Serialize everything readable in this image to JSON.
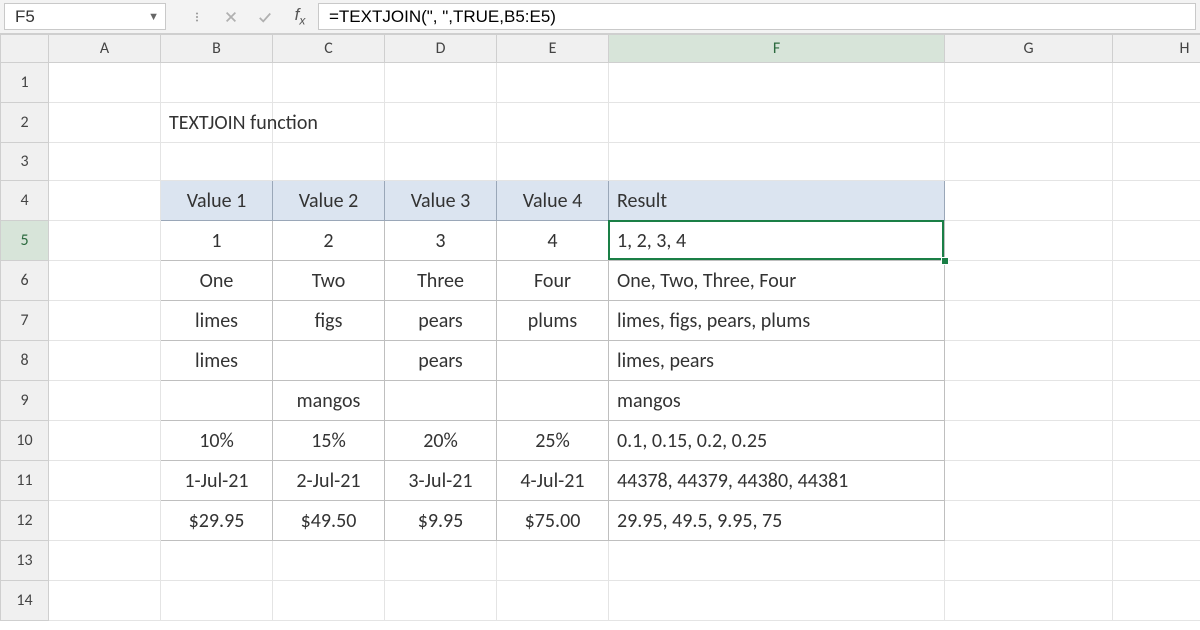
{
  "name_box": "F5",
  "formula": "=TEXTJOIN(\", \",TRUE,B5:E5)",
  "fx_label": "fx",
  "columns": [
    "A",
    "B",
    "C",
    "D",
    "E",
    "F",
    "G",
    "H"
  ],
  "rows": [
    "1",
    "2",
    "3",
    "4",
    "5",
    "6",
    "7",
    "8",
    "9",
    "10",
    "11",
    "12",
    "13",
    "14"
  ],
  "active_col": "F",
  "active_row": "5",
  "title": "TEXTJOIN function",
  "headers": {
    "v1": "Value 1",
    "v2": "Value 2",
    "v3": "Value 3",
    "v4": "Value 4",
    "result": "Result"
  },
  "data_rows": [
    {
      "b": "1",
      "c": "2",
      "d": "3",
      "e": "4",
      "f": "1, 2, 3, 4"
    },
    {
      "b": "One",
      "c": "Two",
      "d": "Three",
      "e": "Four",
      "f": "One, Two, Three, Four"
    },
    {
      "b": "limes",
      "c": "figs",
      "d": "pears",
      "e": "plums",
      "f": "limes, figs, pears, plums"
    },
    {
      "b": "limes",
      "c": "",
      "d": "pears",
      "e": "",
      "f": "limes, pears"
    },
    {
      "b": "",
      "c": "mangos",
      "d": "",
      "e": "",
      "f": "mangos"
    },
    {
      "b": "10%",
      "c": "15%",
      "d": "20%",
      "e": "25%",
      "f": "0.1, 0.15, 0.2, 0.25"
    },
    {
      "b": "1-Jul-21",
      "c": "2-Jul-21",
      "d": "3-Jul-21",
      "e": "4-Jul-21",
      "f": "44378, 44379, 44380, 44381"
    },
    {
      "b": "$29.95",
      "c": "$49.50",
      "d": "$9.95",
      "e": "$75.00",
      "f": "29.95, 49.5, 9.95, 75"
    }
  ]
}
